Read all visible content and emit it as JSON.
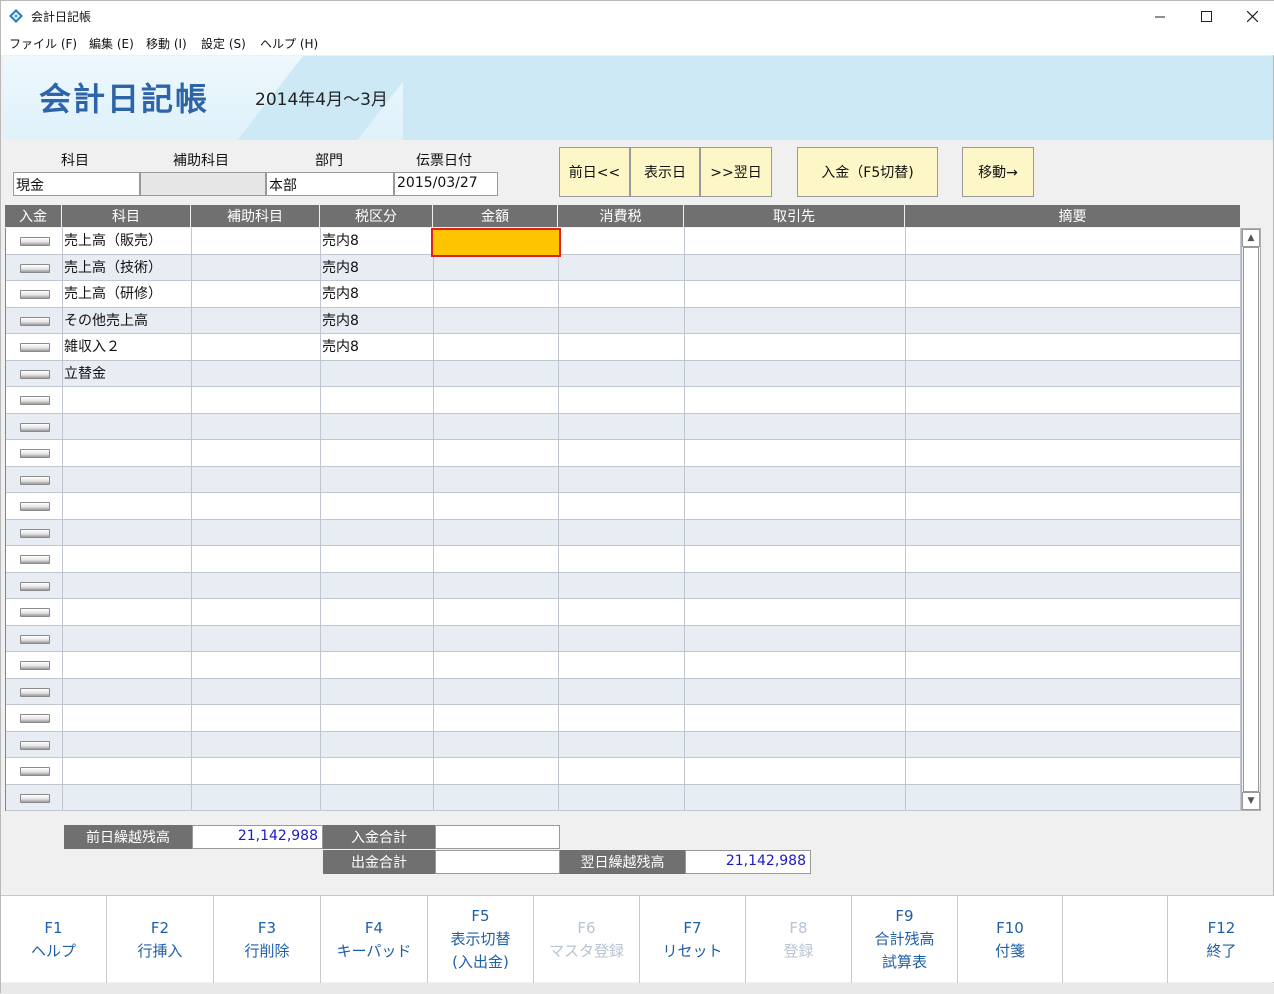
{
  "window": {
    "title": "会計日記帳"
  },
  "menu": [
    {
      "label": "ファイル (F)"
    },
    {
      "label": "編集 (E)"
    },
    {
      "label": "移動 (I)"
    },
    {
      "label": "設定 (S)"
    },
    {
      "label": "ヘルプ (H)"
    }
  ],
  "banner": {
    "title": "会計日記帳",
    "period": "2014年4月～3月"
  },
  "header": {
    "labels": {
      "account": "科目",
      "sub_account": "補助科目",
      "department": "部門",
      "voucher_date": "伝票日付"
    },
    "values": {
      "account": "現金",
      "sub_account": "",
      "department": "本部",
      "voucher_date": "2015/03/27"
    }
  },
  "buttons": {
    "prev_day": "前日<<",
    "show_day": "表示日",
    "next_day": ">>翌日",
    "deposit_toggle": "入金（F5切替)",
    "move": "移動→"
  },
  "grid": {
    "columns": [
      "入金",
      "科目",
      "補助科目",
      "税区分",
      "金額",
      "消費税",
      "取引先",
      "摘要"
    ],
    "rows": [
      {
        "account": "売上高（販売）",
        "sub": "",
        "tax": "売内8",
        "amount": "",
        "ctax": "",
        "partner": "",
        "memo": ""
      },
      {
        "account": "売上高（技術）",
        "sub": "",
        "tax": "売内8",
        "amount": "",
        "ctax": "",
        "partner": "",
        "memo": ""
      },
      {
        "account": "売上高（研修）",
        "sub": "",
        "tax": "売内8",
        "amount": "",
        "ctax": "",
        "partner": "",
        "memo": ""
      },
      {
        "account": "その他売上高",
        "sub": "",
        "tax": "売内8",
        "amount": "",
        "ctax": "",
        "partner": "",
        "memo": ""
      },
      {
        "account": "雑収入２",
        "sub": "",
        "tax": "売内8",
        "amount": "",
        "ctax": "",
        "partner": "",
        "memo": ""
      },
      {
        "account": "立替金",
        "sub": "",
        "tax": "",
        "amount": "",
        "ctax": "",
        "partner": "",
        "memo": ""
      },
      {
        "account": "",
        "sub": "",
        "tax": "",
        "amount": "",
        "ctax": "",
        "partner": "",
        "memo": ""
      },
      {
        "account": "",
        "sub": "",
        "tax": "",
        "amount": "",
        "ctax": "",
        "partner": "",
        "memo": ""
      },
      {
        "account": "",
        "sub": "",
        "tax": "",
        "amount": "",
        "ctax": "",
        "partner": "",
        "memo": ""
      },
      {
        "account": "",
        "sub": "",
        "tax": "",
        "amount": "",
        "ctax": "",
        "partner": "",
        "memo": ""
      },
      {
        "account": "",
        "sub": "",
        "tax": "",
        "amount": "",
        "ctax": "",
        "partner": "",
        "memo": ""
      },
      {
        "account": "",
        "sub": "",
        "tax": "",
        "amount": "",
        "ctax": "",
        "partner": "",
        "memo": ""
      },
      {
        "account": "",
        "sub": "",
        "tax": "",
        "amount": "",
        "ctax": "",
        "partner": "",
        "memo": ""
      },
      {
        "account": "",
        "sub": "",
        "tax": "",
        "amount": "",
        "ctax": "",
        "partner": "",
        "memo": ""
      },
      {
        "account": "",
        "sub": "",
        "tax": "",
        "amount": "",
        "ctax": "",
        "partner": "",
        "memo": ""
      },
      {
        "account": "",
        "sub": "",
        "tax": "",
        "amount": "",
        "ctax": "",
        "partner": "",
        "memo": ""
      },
      {
        "account": "",
        "sub": "",
        "tax": "",
        "amount": "",
        "ctax": "",
        "partner": "",
        "memo": ""
      },
      {
        "account": "",
        "sub": "",
        "tax": "",
        "amount": "",
        "ctax": "",
        "partner": "",
        "memo": ""
      },
      {
        "account": "",
        "sub": "",
        "tax": "",
        "amount": "",
        "ctax": "",
        "partner": "",
        "memo": ""
      },
      {
        "account": "",
        "sub": "",
        "tax": "",
        "amount": "",
        "ctax": "",
        "partner": "",
        "memo": ""
      },
      {
        "account": "",
        "sub": "",
        "tax": "",
        "amount": "",
        "ctax": "",
        "partner": "",
        "memo": ""
      },
      {
        "account": "",
        "sub": "",
        "tax": "",
        "amount": "",
        "ctax": "",
        "partner": "",
        "memo": ""
      }
    ]
  },
  "totals": {
    "prev_balance_label": "前日繰越残高",
    "prev_balance": "21,142,988",
    "deposit_total_label": "入金合計",
    "deposit_total": "",
    "withdraw_total_label": "出金合計",
    "withdraw_total": "",
    "next_balance_label": "翌日繰越残高",
    "next_balance": "21,142,988"
  },
  "fkeys": [
    {
      "key": "F1",
      "line1": "ヘルプ",
      "line2": "",
      "enabled": true
    },
    {
      "key": "F2",
      "line1": "行挿入",
      "line2": "",
      "enabled": true
    },
    {
      "key": "F3",
      "line1": "行削除",
      "line2": "",
      "enabled": true
    },
    {
      "key": "F4",
      "line1": "キーパッド",
      "line2": "",
      "enabled": true
    },
    {
      "key": "F5",
      "line1": "表示切替",
      "line2": "(入出金)",
      "enabled": true
    },
    {
      "key": "F6",
      "line1": "マスタ登録",
      "line2": "",
      "enabled": false
    },
    {
      "key": "F7",
      "line1": "リセット",
      "line2": "",
      "enabled": true
    },
    {
      "key": "F8",
      "line1": "登録",
      "line2": "",
      "enabled": false
    },
    {
      "key": "F9",
      "line1": "合計残高",
      "line2": "試算表",
      "enabled": true
    },
    {
      "key": "F10",
      "line1": "付箋",
      "line2": "",
      "enabled": true
    },
    {
      "key": "",
      "line1": "",
      "line2": "",
      "enabled": false
    },
    {
      "key": "F12",
      "line1": "終了",
      "line2": "",
      "enabled": true
    }
  ],
  "colors": {
    "accent": "#2e64a8",
    "header_gray": "#707070",
    "highlight": "#ffc400",
    "button_yellow": "#fdf6c6",
    "fkey_text": "#1f5fa8"
  }
}
